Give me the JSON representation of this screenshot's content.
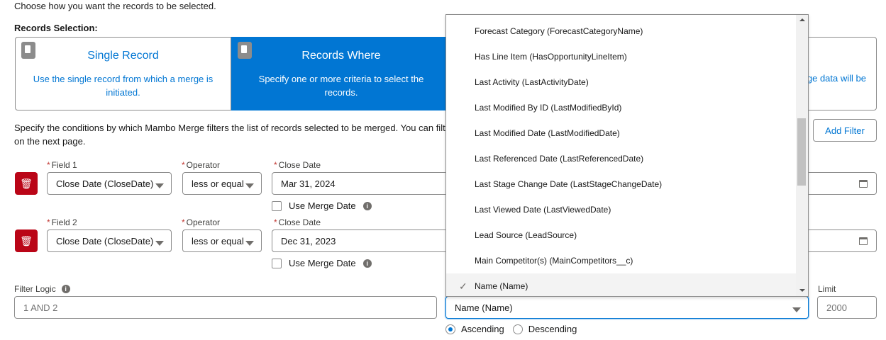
{
  "intro": "Choose how you want the records to be selected.",
  "records_selection": {
    "label": "Records Selection:",
    "tiles": [
      {
        "title": "Single Record",
        "description": "Use the single record from which a merge is initiated.",
        "selected": false,
        "icon": "document-icon"
      },
      {
        "title": "Records Where",
        "description": "Specify one or more criteria to select the records.",
        "selected": true,
        "icon": "documents-icon"
      },
      {
        "description_partial": "ge data will be"
      }
    ]
  },
  "conditions_text": "Specify the conditions by which Mambo Merge filters the list of records selected to be merged. You can filt",
  "conditions_text_2": "on the next page.",
  "add_filter": "Add Filter",
  "filters": [
    {
      "field_label": "Field 1",
      "field": "Close Date (CloseDate)",
      "operator_label": "Operator",
      "operator": "less or equal",
      "value_label": "Close Date",
      "value": "Mar 31, 2024",
      "merge_date_label": "Use Merge Date",
      "merge_date": false
    },
    {
      "field_label": "Field 2",
      "field": "Close Date (CloseDate)",
      "operator_label": "Operator",
      "operator": "less or equal",
      "value_label": "Close Date",
      "value": "Dec 31, 2023",
      "merge_date_label": "Use Merge Date",
      "merge_date": false
    }
  ],
  "filter_logic": {
    "label": "Filter Logic",
    "placeholder": "1 AND 2"
  },
  "sort": {
    "value": "Name (Name)",
    "ascending": "Ascending",
    "descending": "Descending",
    "direction": "Ascending"
  },
  "limit": {
    "label": "Limit",
    "placeholder": "2000"
  },
  "dropdown": {
    "options": [
      "Forecast Category (ForecastCategoryName)",
      "Has Line Item (HasOpportunityLineItem)",
      "Last Activity (LastActivityDate)",
      "Last Modified By ID (LastModifiedById)",
      "Last Modified Date (LastModifiedDate)",
      "Last Referenced Date (LastReferencedDate)",
      "Last Stage Change Date (LastStageChangeDate)",
      "Last Viewed Date (LastViewedDate)",
      "Lead Source (LeadSource)",
      "Main Competitor(s) (MainCompetitors__c)",
      "Name (Name)"
    ],
    "selected": "Name (Name)"
  },
  "colors": {
    "brand": "#0176d3",
    "danger": "#ba0517"
  }
}
